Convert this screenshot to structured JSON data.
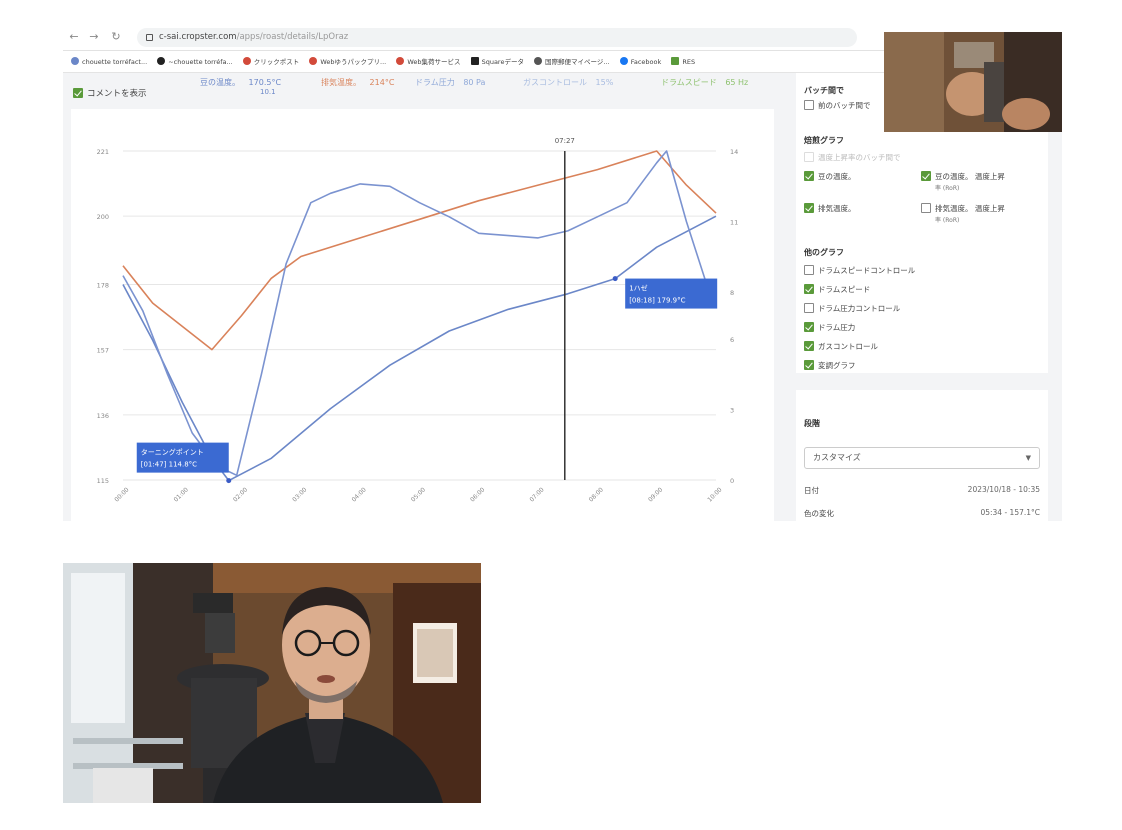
{
  "browser": {
    "url_host": "c-sai.cropster.com",
    "url_path": "/apps/roast/details/LpOraz",
    "bookmarks": [
      "chouette torréfact...",
      "~chouette torréfa...",
      "クリックポスト",
      "Webゆうパックプリ...",
      "Web集荷サービス",
      "Squareデータ",
      "国際郵便マイページ...",
      "Facebook",
      "RES"
    ]
  },
  "legend": {
    "comment_toggle": "コメントを表示",
    "items": [
      {
        "label": "豆の温度。",
        "value": "170.5°C",
        "sub": "10.1",
        "color": "#6b87c8"
      },
      {
        "label": "排気温度。",
        "value": "214°C",
        "sub": "",
        "color": "#d9825a"
      },
      {
        "label": "ドラム圧力",
        "value": "80 Pa",
        "sub": "",
        "color": "#8fa8d8"
      },
      {
        "label": "ガスコントロール",
        "value": "15%",
        "sub": "",
        "color": "#a8bce0"
      },
      {
        "label": "ドラムスピード",
        "value": "65 Hz",
        "sub": "",
        "color": "#8fc270"
      }
    ]
  },
  "chart_data": {
    "type": "line",
    "x_tick_labels": [
      "00:00",
      "01:00",
      "02:00",
      "03:00",
      "04:00",
      "05:00",
      "06:00",
      "07:00",
      "08:00",
      "09:00",
      "10:00"
    ],
    "y_left_ticks": [
      115,
      136,
      157,
      178,
      200,
      221
    ],
    "y_right_ticks": [
      0,
      3,
      6,
      8,
      11,
      14
    ],
    "cursor_time": "07:27",
    "series": [
      {
        "name": "豆の温度。",
        "color": "#6b87c8",
        "x": [
          "00:00",
          "00:30",
          "01:00",
          "01:30",
          "01:47",
          "02:30",
          "03:30",
          "04:30",
          "05:30",
          "06:30",
          "07:30",
          "08:18",
          "09:00",
          "10:00"
        ],
        "y": [
          178,
          160,
          140,
          122,
          114.8,
          122,
          138,
          152,
          163,
          170,
          175,
          179.9,
          190,
          200
        ]
      },
      {
        "name": "排気温度。",
        "color": "#d9825a",
        "x": [
          "00:00",
          "00:30",
          "01:30",
          "02:00",
          "02:30",
          "03:00",
          "04:00",
          "05:00",
          "06:00",
          "07:00",
          "08:00",
          "09:00",
          "09:30",
          "10:00"
        ],
        "y": [
          184,
          172,
          157,
          168,
          180,
          187,
          193,
          199,
          205,
          210,
          215,
          221,
          210,
          201
        ]
      },
      {
        "name": "ドラム圧力",
        "color": "#7b93d0",
        "axis": "right",
        "x": [
          "00:00",
          "00:20",
          "00:45",
          "01:10",
          "01:35",
          "01:55",
          "02:20",
          "02:45",
          "03:10",
          "03:30",
          "04:00",
          "04:30",
          "05:00",
          "05:30",
          "06:00",
          "06:30",
          "07:00",
          "07:30",
          "08:00",
          "08:30",
          "09:00",
          "09:10",
          "09:30",
          "09:50",
          "10:00"
        ],
        "y": [
          8.7,
          7.2,
          4.5,
          2.0,
          0.6,
          0.2,
          4.5,
          9.2,
          11.8,
          12.2,
          12.6,
          12.5,
          11.8,
          11.2,
          10.5,
          10.4,
          10.3,
          10.6,
          11.2,
          11.8,
          13.5,
          14.0,
          11.0,
          8.4,
          8.2
        ]
      }
    ],
    "annotations": [
      {
        "text": "ターニングポイント",
        "detail": "[01:47] 114.8°C"
      },
      {
        "text": "1ハゼ",
        "detail": "[08:18] 179.9°C"
      }
    ]
  },
  "panel": {
    "batch_heading": "バッチ間で",
    "batch_option": "前のバッチ間で",
    "roast_graph_heading": "焙煎グラフ",
    "roast_options": [
      {
        "label": "温度上昇率のバッチ間で",
        "on": false,
        "dim": true,
        "sub": ""
      },
      {
        "label": "豆の温度。",
        "on": true,
        "dim": false,
        "sub": ""
      },
      {
        "label": "豆の温度。 温度上昇",
        "on": true,
        "dim": false,
        "sub": "率 (RoR)"
      },
      {
        "label": "排気温度。",
        "on": true,
        "dim": false,
        "sub": ""
      },
      {
        "label": "排気温度。 温度上昇",
        "on": false,
        "dim": false,
        "sub": "率 (RoR)"
      }
    ],
    "other_graph_heading": "他のグラフ",
    "other_options": [
      {
        "label": "ドラムスピードコントロール",
        "on": false
      },
      {
        "label": "ドラムスピード",
        "on": true
      },
      {
        "label": "ドラム圧力コントロール",
        "on": false
      },
      {
        "label": "ドラム圧力",
        "on": true
      },
      {
        "label": "ガスコントロール",
        "on": true
      },
      {
        "label": "変調グラフ",
        "on": true
      }
    ]
  },
  "details": {
    "heading": "段階",
    "select_value": "カスタマイズ",
    "date_label": "日付",
    "date_value": "2023/10/18 - 10:35",
    "color_label": "色の変化",
    "color_value": "05:34 - 157.1°C"
  }
}
